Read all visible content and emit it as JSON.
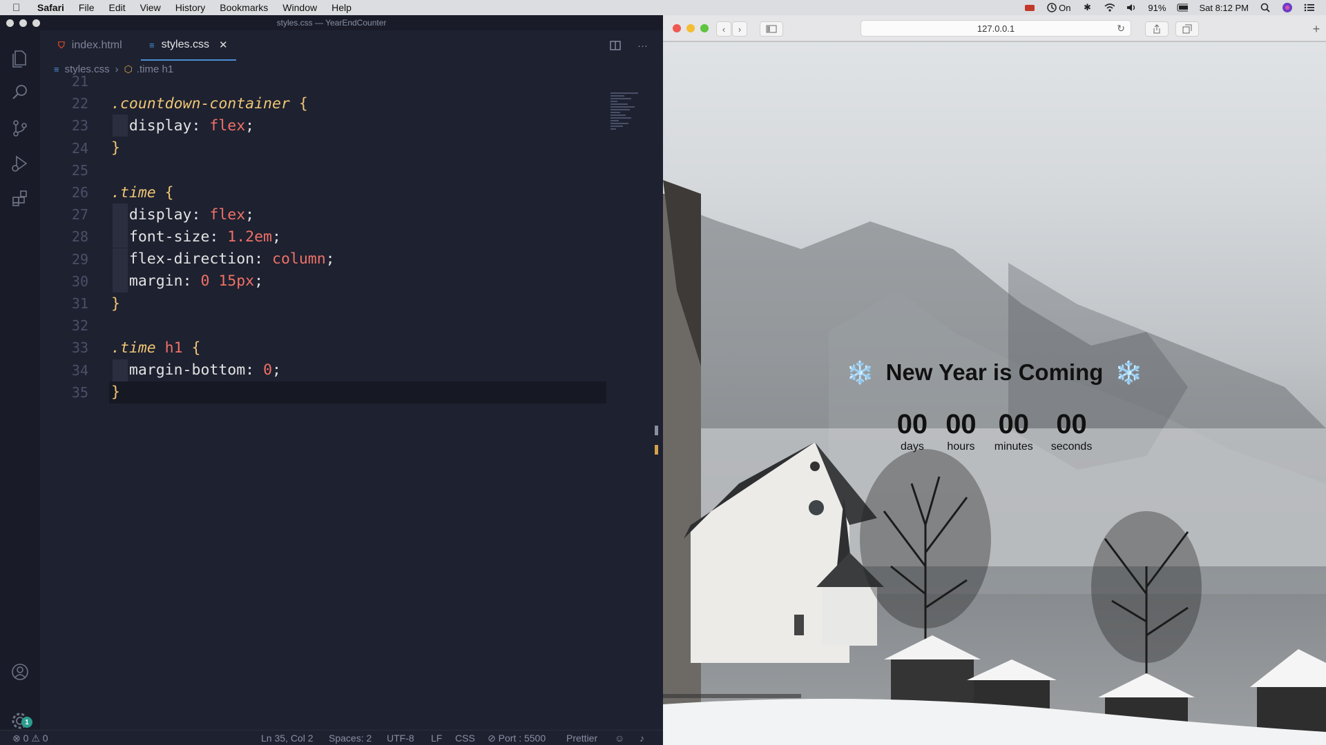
{
  "menubar": {
    "app": "Safari",
    "menus": [
      "File",
      "Edit",
      "View",
      "History",
      "Bookmarks",
      "Window",
      "Help"
    ],
    "time_machine": "On",
    "battery": "91%",
    "clock": "Sat 8:12 PM"
  },
  "vscode": {
    "window_title": "styles.css — YearEndCounter",
    "tabs": [
      {
        "label": "index.html",
        "active": false
      },
      {
        "label": "styles.css",
        "active": true
      }
    ],
    "breadcrumb": {
      "file": "styles.css",
      "symbol": ".time h1"
    },
    "code_lines": [
      {
        "num": "21",
        "tokens": []
      },
      {
        "num": "22",
        "tokens": [
          {
            "t": ".countdown-container",
            "c": "sel"
          },
          {
            "t": " {",
            "c": "brace"
          }
        ]
      },
      {
        "num": "23",
        "tokens": [
          {
            "t": "  display",
            "c": "prop"
          },
          {
            "t": ": ",
            "c": "punct"
          },
          {
            "t": "flex",
            "c": "val"
          },
          {
            "t": ";",
            "c": "punct"
          }
        ]
      },
      {
        "num": "24",
        "tokens": [
          {
            "t": "}",
            "c": "brace"
          }
        ]
      },
      {
        "num": "25",
        "tokens": []
      },
      {
        "num": "26",
        "tokens": [
          {
            "t": ".time",
            "c": "sel"
          },
          {
            "t": " {",
            "c": "brace"
          }
        ]
      },
      {
        "num": "27",
        "tokens": [
          {
            "t": "  display",
            "c": "prop"
          },
          {
            "t": ": ",
            "c": "punct"
          },
          {
            "t": "flex",
            "c": "val"
          },
          {
            "t": ";",
            "c": "punct"
          }
        ]
      },
      {
        "num": "28",
        "tokens": [
          {
            "t": "  font-size",
            "c": "prop"
          },
          {
            "t": ": ",
            "c": "punct"
          },
          {
            "t": "1.2em",
            "c": "val"
          },
          {
            "t": ";",
            "c": "punct"
          }
        ]
      },
      {
        "num": "29",
        "tokens": [
          {
            "t": "  flex-direction",
            "c": "prop"
          },
          {
            "t": ": ",
            "c": "punct"
          },
          {
            "t": "column",
            "c": "val"
          },
          {
            "t": ";",
            "c": "punct"
          }
        ]
      },
      {
        "num": "30",
        "tokens": [
          {
            "t": "  margin",
            "c": "prop"
          },
          {
            "t": ": ",
            "c": "punct"
          },
          {
            "t": "0 15px",
            "c": "val"
          },
          {
            "t": ";",
            "c": "punct"
          }
        ]
      },
      {
        "num": "31",
        "tokens": [
          {
            "t": "}",
            "c": "brace"
          }
        ]
      },
      {
        "num": "32",
        "tokens": []
      },
      {
        "num": "33",
        "tokens": [
          {
            "t": ".time",
            "c": "sel"
          },
          {
            "t": " h1",
            "c": "tag"
          },
          {
            "t": " {",
            "c": "brace"
          }
        ]
      },
      {
        "num": "34",
        "tokens": [
          {
            "t": "  margin-bottom",
            "c": "prop"
          },
          {
            "t": ": ",
            "c": "punct"
          },
          {
            "t": "0",
            "c": "val"
          },
          {
            "t": ";",
            "c": "punct"
          }
        ]
      },
      {
        "num": "35",
        "tokens": [
          {
            "t": "}",
            "c": "brace"
          }
        ]
      }
    ],
    "status": {
      "errors": "0",
      "warnings": "0",
      "position": "Ln 35, Col 2",
      "spaces": "Spaces: 2",
      "encoding": "UTF-8",
      "eol": "LF",
      "language": "CSS",
      "port": "Port : 5500",
      "formatter": "Prettier"
    },
    "accounts_badge": "1"
  },
  "safari": {
    "url": "127.0.0.1",
    "page": {
      "title": "New Year is Coming",
      "flake": "❄️",
      "units": [
        {
          "value": "00",
          "label": "days"
        },
        {
          "value": "00",
          "label": "hours"
        },
        {
          "value": "00",
          "label": "minutes"
        },
        {
          "value": "00",
          "label": "seconds"
        }
      ]
    }
  },
  "colors": {
    "editor_bg": "#1e2130",
    "selector": "#f0c674",
    "value": "#f07167",
    "accent_blue": "#4a8fd6",
    "flake": "#8ecdf2"
  }
}
